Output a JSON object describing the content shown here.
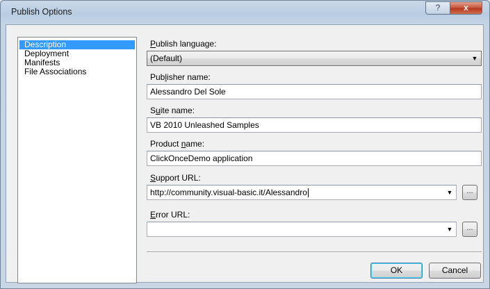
{
  "window": {
    "title": "Publish Options",
    "help_label": "?",
    "close_label": "x"
  },
  "nav": {
    "items": [
      {
        "label": "Description",
        "selected": true
      },
      {
        "label": "Deployment",
        "selected": false
      },
      {
        "label": "Manifests",
        "selected": false
      },
      {
        "label": "File Associations",
        "selected": false
      }
    ]
  },
  "form": {
    "publish_language": {
      "label_mnemonic": "P",
      "label_rest": "ublish language:",
      "value": "(Default)"
    },
    "publisher_name": {
      "label_pre": "Pub",
      "label_mnemonic": "l",
      "label_post": "isher name:",
      "value": "Alessandro Del Sole"
    },
    "suite_name": {
      "label_pre": "S",
      "label_mnemonic": "u",
      "label_post": "ite name:",
      "value": "VB 2010 Unleashed Samples"
    },
    "product_name": {
      "label_pre": "Product ",
      "label_mnemonic": "n",
      "label_post": "ame:",
      "value": "ClickOnceDemo application"
    },
    "support_url": {
      "label_mnemonic": "S",
      "label_rest": "upport URL:",
      "value": "http://community.visual-basic.it/Alessandro"
    },
    "error_url": {
      "label_mnemonic": "E",
      "label_rest": "rror URL:",
      "value": ""
    },
    "browse_label": "..."
  },
  "buttons": {
    "ok": "OK",
    "cancel": "Cancel"
  },
  "icons": {
    "dropdown": "chevron-down-icon"
  }
}
